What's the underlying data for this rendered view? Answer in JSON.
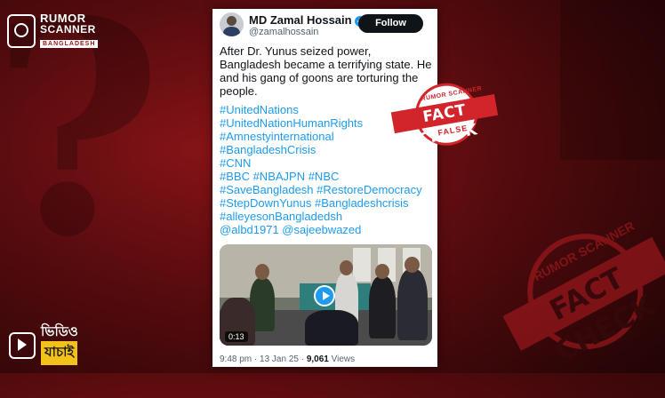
{
  "brand": {
    "logo_line1": "RUMOR",
    "logo_line2": "SCANNER",
    "logo_line3": "BANGLADESH",
    "video_badge_line1": "ভিডিও",
    "video_badge_line2": "যাচাই"
  },
  "tweet": {
    "author_name": "MD Zamal Hossain",
    "verified_icon": "✓",
    "handle": "@zamalhossain",
    "follow_label": "Follow",
    "text": "After Dr. Yunus seized power, Bangladesh became a terrifying state. He and his gang of goons are torturing the people.",
    "hashtag_lines": [
      "#UnitedNations",
      "#UnitedNationHumanRights",
      "#Amnestyinternational",
      "#BangladeshCrisis",
      "#CNN",
      "#BBC #NBAJPN #NBC",
      "#SaveBangladesh #RestoreDemocracy",
      "#StepDownYunus #Bangladeshcrisis",
      "#alleyesonBangladedsh",
      "@albd1971 @sajeebwazed"
    ],
    "video_duration": "0:13",
    "time_date": "9:48 pm · 13 Jan 25 · ",
    "views_count": "9,061",
    "views_label": " Views"
  },
  "stamp_small": {
    "arc_text": "RUMOR SCANNER",
    "band_text": "FACT CHECK",
    "verdict": "FALSE"
  },
  "stamp_large": {
    "arc_text": "RUMOR SCANNER",
    "band_text": "FACT CHECK"
  },
  "colors": {
    "background": "#7a1115",
    "stamp_red": "#d1242b",
    "link_blue": "#1d9bf0",
    "badge_yellow": "#f3c21a"
  }
}
